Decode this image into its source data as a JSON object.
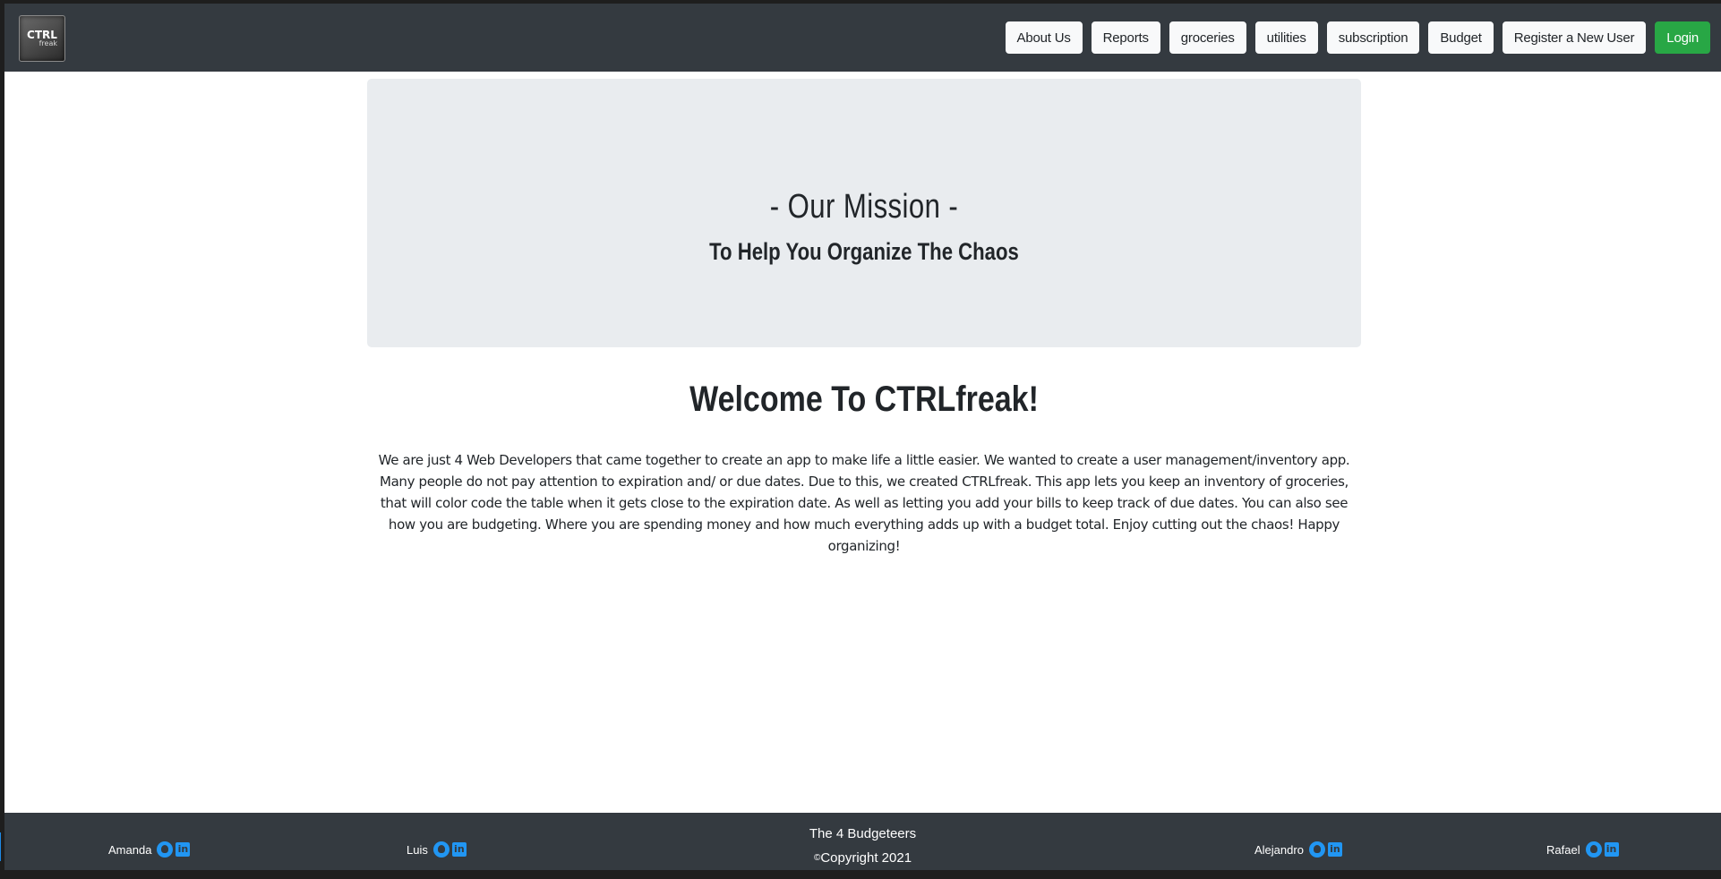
{
  "brand": {
    "logo_text_top": "CTRL",
    "logo_text_bottom": "freak"
  },
  "nav": {
    "items": [
      {
        "label": "About Us"
      },
      {
        "label": "Reports"
      },
      {
        "label": "groceries"
      },
      {
        "label": "utilities"
      },
      {
        "label": "subscription"
      },
      {
        "label": "Budget"
      },
      {
        "label": "Register a New User"
      }
    ],
    "login_label": "Login"
  },
  "jumbotron": {
    "title": "- Our Mission -",
    "subtitle": "To Help You Organize The Chaos"
  },
  "main": {
    "welcome": "Welcome To CTRLfreak!",
    "about": "We are just 4 Web Developers that came together to create an app to make life a little easier. We wanted to create a user management/inventory app. Many people do not pay attention to expiration and/ or due dates. Due to this, we created CTRLfreak. This app lets you keep an inventory of groceries, that will color code the table when it gets close to the expiration date. As well as letting you add your bills to keep track of due dates. You can also see how you are budgeting. Where you are spending money and how much everything adds up with a budget total. Enjoy cutting out the chaos! Happy organizing!"
  },
  "footer": {
    "team": "The 4 Budgeteers",
    "copyright_symbol": "©",
    "copyright": "Copyright 2021",
    "members": [
      {
        "name": "Amanda",
        "icons": [
          "github-icon",
          "linkedin-icon"
        ]
      },
      {
        "name": "Luis",
        "icons": [
          "github-icon",
          "linkedin-icon"
        ]
      },
      {
        "name": "Alejandro",
        "icons": [
          "github-icon",
          "linkedin-icon"
        ]
      },
      {
        "name": "Rafael",
        "icons": [
          "github-icon",
          "linkedin-icon"
        ]
      }
    ]
  },
  "colors": {
    "navbar_bg": "#343a40",
    "jumbotron_bg": "#e9ecef",
    "login_green": "#28a745",
    "icon_blue": "#2196f3"
  }
}
